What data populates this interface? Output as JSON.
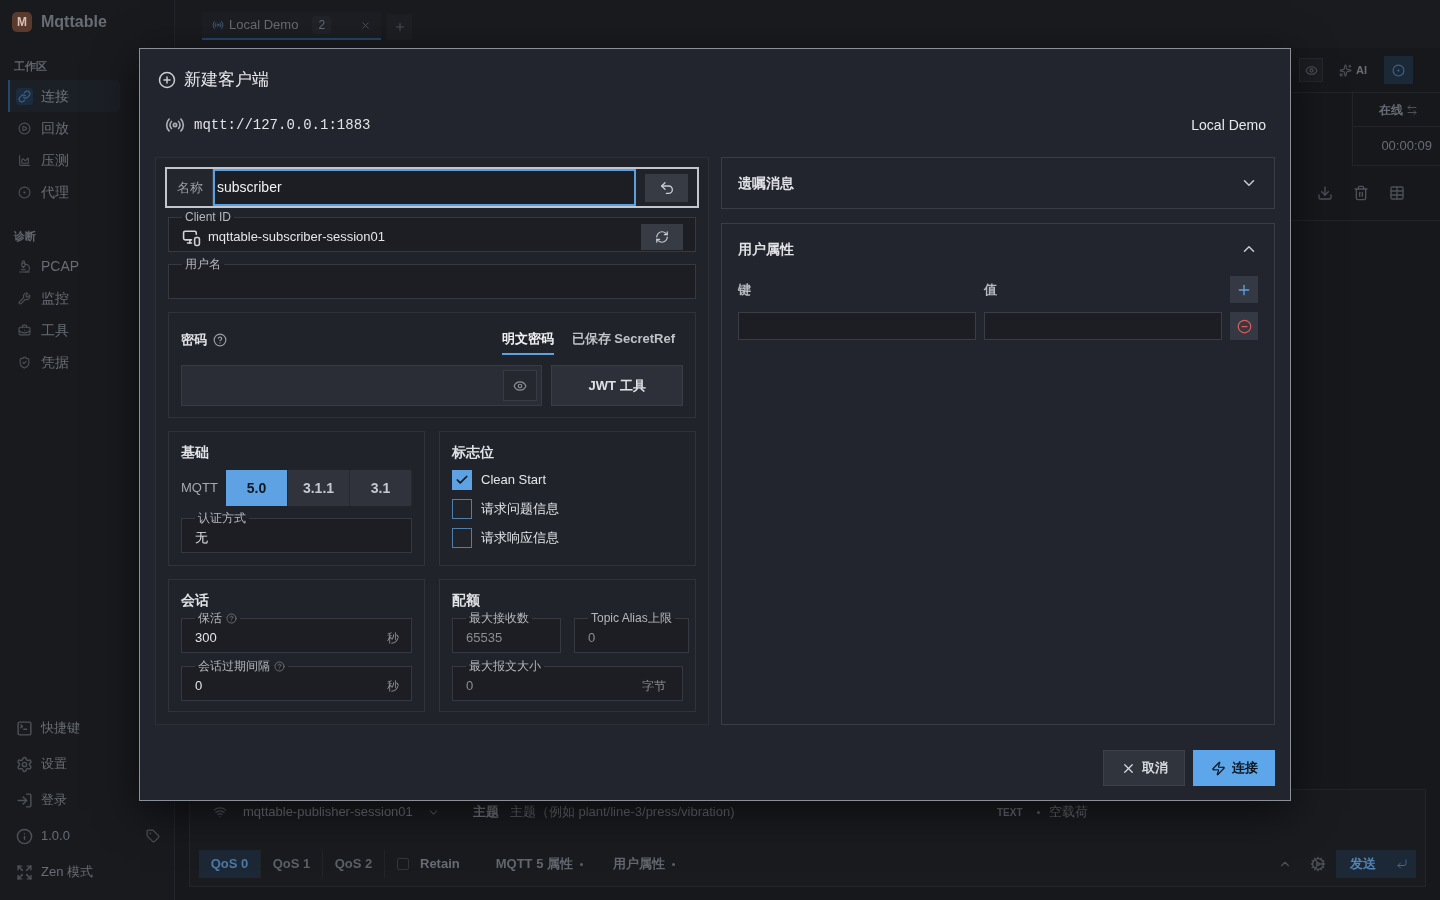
{
  "app": {
    "logo_letter": "M",
    "name": "Mqttable"
  },
  "sidebar": {
    "sections": [
      {
        "title": "工作区",
        "items": [
          {
            "label": "连接",
            "selected": true
          },
          {
            "label": "回放",
            "selected": false
          },
          {
            "label": "压测",
            "selected": false
          },
          {
            "label": "代理",
            "selected": false
          }
        ]
      },
      {
        "title": "诊断",
        "items": [
          {
            "label": "PCAP",
            "selected": false
          },
          {
            "label": "监控",
            "selected": false
          },
          {
            "label": "工具",
            "selected": false
          },
          {
            "label": "凭据",
            "selected": false
          }
        ]
      }
    ],
    "footer_items": [
      {
        "label": "快捷键"
      },
      {
        "label": "设置"
      },
      {
        "label": "登录"
      },
      {
        "label": "1.0.0"
      },
      {
        "label": "Zen 模式"
      }
    ]
  },
  "tabs": [
    {
      "label": "Local Demo",
      "badge": "2",
      "selected": true
    }
  ],
  "session_panel": {
    "ai_label": "AI",
    "status": "在线",
    "elapsed": "00:00:09"
  },
  "composer": {
    "client": "mqttable-publisher-session01",
    "topic_label": "主题",
    "topic_placeholder": "主题（例如 plant/line-3/press/vibration)",
    "format": "TEXT",
    "payload_placeholder": "空载荷",
    "qos": [
      {
        "label": "QoS 0",
        "selected": true
      },
      {
        "label": "QoS 1",
        "selected": false
      },
      {
        "label": "QoS 2",
        "selected": false
      }
    ],
    "retain": {
      "label": "Retain",
      "checked": false
    },
    "option_menus": [
      "MQTT 5 属性",
      "用户属性"
    ],
    "send_label": "发送"
  },
  "dialog": {
    "title": "新建客户端",
    "broker_url": "mqtt://127.0.0.1:1883",
    "broker_name": "Local Demo",
    "name_field": {
      "label": "名称",
      "value": "subscriber",
      "focused": true
    },
    "client_id": {
      "label": "Client ID",
      "value": "mqttable-subscriber-session01"
    },
    "username": {
      "label": "用户名"
    },
    "password": {
      "label": "密码",
      "tabs": [
        {
          "label": "明文密码",
          "selected": true
        },
        {
          "label": "已保存 SecretRef",
          "selected": false
        }
      ],
      "jwt_button": "JWT 工具"
    },
    "basic": {
      "title": "基础",
      "protocol_label": "MQTT",
      "versions": [
        {
          "label": "5.0",
          "selected": true
        },
        {
          "label": "3.1.1",
          "selected": false
        },
        {
          "label": "3.1",
          "selected": false
        }
      ],
      "auth": {
        "label": "认证方式",
        "value": "无"
      }
    },
    "flags": {
      "title": "标志位",
      "options": [
        {
          "label": "Clean Start",
          "checked": true
        },
        {
          "label": "请求问题信息",
          "checked": false
        },
        {
          "label": "请求响应信息",
          "checked": false
        }
      ]
    },
    "session": {
      "title": "会话",
      "fields": [
        {
          "label": "保活",
          "help": true,
          "value": "300",
          "unit": "秒"
        },
        {
          "label": "会话过期间隔",
          "help": true,
          "value": "0",
          "unit": "秒"
        }
      ]
    },
    "quota": {
      "title": "配额",
      "fields": [
        {
          "label": "最大接收数",
          "placeholder": "65535"
        },
        {
          "label": "Topic Alias上限",
          "placeholder": "0"
        },
        {
          "label": "最大报文大小",
          "placeholder": "0",
          "unit": "字节"
        }
      ]
    },
    "will": {
      "title": "遗嘱消息",
      "expanded": false
    },
    "user_properties": {
      "title": "用户属性",
      "expanded": true,
      "key_header": "键",
      "value_header": "值"
    },
    "buttons": {
      "cancel": "取消",
      "connect": "连接"
    }
  }
}
